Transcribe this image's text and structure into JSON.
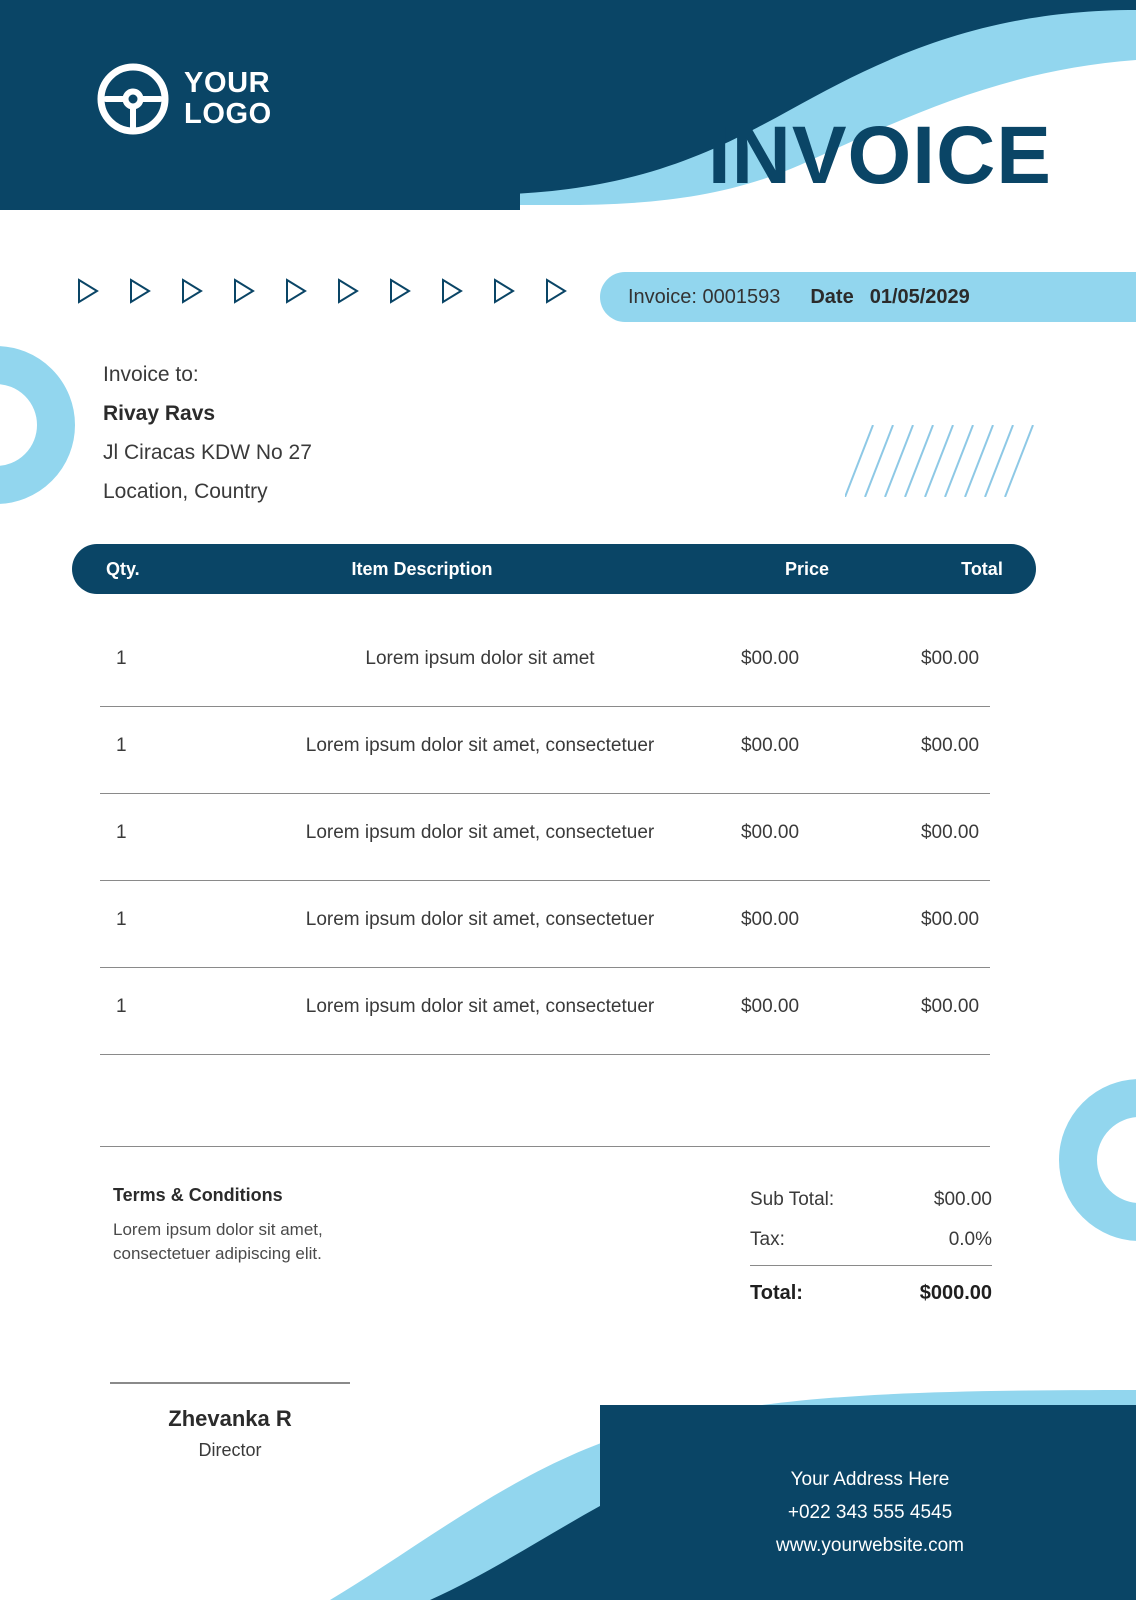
{
  "colors": {
    "navy": "#0A4566",
    "light_blue": "#92D6EE",
    "stripe_blue": "#8EC9E6",
    "text_dark": "#3a3a3a",
    "rule": "#8a8a8a"
  },
  "header": {
    "logo_line1": "YOUR",
    "logo_line2": "LOGO",
    "logo_icon": "steering-wheel-icon",
    "title": "INVOICE"
  },
  "decor": {
    "triangle_icon": "play-triangle-icon",
    "triangle_count": 10,
    "stripes_icon": "diagonal-stripes",
    "ring_icon": "donut-ring"
  },
  "meta": {
    "invoice_label": "Invoice: 0001593",
    "date_label": "Date",
    "date_value": "01/05/2029"
  },
  "bill_to": {
    "heading": "Invoice to:",
    "name": "Rivay Ravs",
    "address_line1": "Jl Ciracas KDW No 27",
    "address_line2": "Location, Country"
  },
  "table": {
    "headers": {
      "qty": "Qty.",
      "description": "Item Description",
      "price": "Price",
      "total": "Total"
    },
    "rows": [
      {
        "qty": "1",
        "description": "Lorem ipsum dolor sit amet",
        "price": "$00.00",
        "total": "$00.00"
      },
      {
        "qty": "1",
        "description": "Lorem ipsum dolor sit amet, consectetuer",
        "price": "$00.00",
        "total": "$00.00"
      },
      {
        "qty": "1",
        "description": "Lorem ipsum dolor sit amet, consectetuer",
        "price": "$00.00",
        "total": "$00.00"
      },
      {
        "qty": "1",
        "description": "Lorem ipsum dolor sit amet, consectetuer",
        "price": "$00.00",
        "total": "$00.00"
      },
      {
        "qty": "1",
        "description": "Lorem ipsum dolor sit amet, consectetuer",
        "price": "$00.00",
        "total": "$00.00"
      }
    ]
  },
  "terms": {
    "title": "Terms & Conditions",
    "line1": "Lorem ipsum dolor sit amet,",
    "line2": "consectetuer adipiscing elit."
  },
  "totals": {
    "subtotal_label": "Sub Total:",
    "subtotal_value": "$00.00",
    "tax_label": "Tax:",
    "tax_value": "0.0%",
    "total_label": "Total:",
    "total_value": "$000.00"
  },
  "signature": {
    "name": "Zhevanka R",
    "role": "Director"
  },
  "footer": {
    "address": "Your Address Here",
    "phone": "+022 343 555 4545",
    "website": "www.yourwebsite.com"
  }
}
